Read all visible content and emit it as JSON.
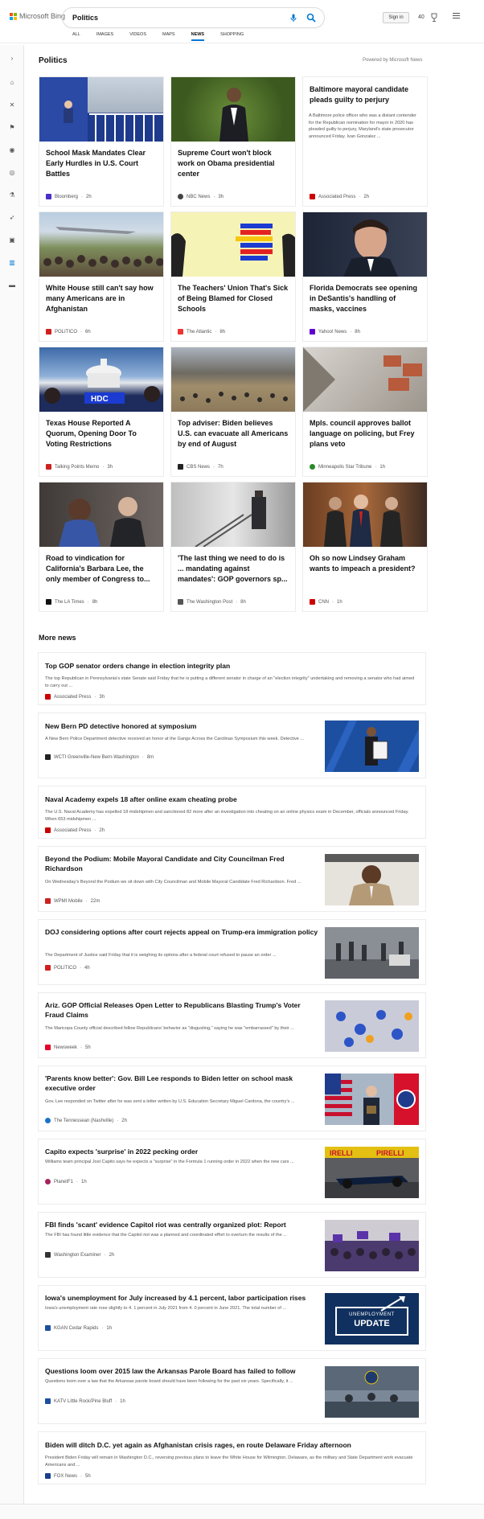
{
  "header": {
    "brand": "Microsoft Bing",
    "search_value": "Politics",
    "signin_label": "Sign in",
    "points": "40"
  },
  "tabs": [
    {
      "label": "ALL"
    },
    {
      "label": "IMAGES"
    },
    {
      "label": "VIDEOS"
    },
    {
      "label": "MAPS"
    },
    {
      "label": "NEWS"
    },
    {
      "label": "SHOPPING"
    }
  ],
  "rail_icons": [
    "chevron-right-icon",
    "home-icon",
    "tools-icon",
    "flag-icon",
    "location-icon",
    "globe-icon",
    "science-icon",
    "rocket-icon",
    "film-icon",
    "bank-icon",
    "card-icon"
  ],
  "page": {
    "title": "Politics",
    "powered_by": "Powered by Microsoft News",
    "more_news_title": "More news"
  },
  "cards": [
    {
      "title": "School Mask Mandates Clear Early Hurdles in U.S. Court Battles",
      "source": "Bloomberg",
      "age": "2h",
      "logo_color": "#4b2fc8"
    },
    {
      "title": "Supreme Court won't block work on Obama presidential center",
      "source": "NBC News",
      "age": "3h",
      "logo_color": "#444"
    },
    {
      "title": "Baltimore mayoral candidate pleads guilty to perjury",
      "desc": "A Baltimore police officer who was a distant contender for the Republican nomination for mayor in 2020 has pleaded guilty to perjury, Maryland's state prosecutor announced Friday. Ivan Gonzalez ...",
      "source": "Associated Press",
      "age": "2h",
      "logo_color": "#c00"
    },
    {
      "title": "White House still can't say how many Americans are in Afghanistan",
      "source": "POLITICO",
      "age": "6h",
      "logo_color": "#d21f1f"
    },
    {
      "title": "The Teachers' Union That's Sick of Being Blamed for Closed Schools",
      "source": "The Atlantic",
      "age": "8h",
      "logo_color": "#e33"
    },
    {
      "title": "Florida Democrats see opening in DeSantis's handling of masks, vaccines",
      "source": "Yahoo! News",
      "age": "8h",
      "logo_color": "#6001d2"
    },
    {
      "title": "Texas House Reported A Quorum, Opening Door To Voting Restrictions",
      "source": "Talking Points Memo",
      "age": "3h",
      "logo_color": "#c22"
    },
    {
      "title": "Top adviser: Biden believes U.S. can evacuate all Americans by end of August",
      "source": "CBS News",
      "age": "7h",
      "logo_color": "#222"
    },
    {
      "title": "Mpls. council approves ballot language on policing, but Frey plans veto",
      "source": "Minneapolis Star Tribune",
      "age": "1h",
      "logo_color": "#2a8a2a"
    },
    {
      "title": "Road to vindication for California's Barbara Lee, the only member of Congress to...",
      "source": "The LA Times",
      "age": "8h",
      "logo_color": "#111"
    },
    {
      "title": "'The last thing we need to do is ... mandating against mandates': GOP governors sp...",
      "source": "The Washington Post",
      "age": "8h",
      "logo_color": "#555"
    },
    {
      "title": "Oh so now Lindsey Graham wants to impeach a president?",
      "source": "CNN",
      "age": "1h",
      "logo_color": "#cc0000"
    }
  ],
  "more_news": [
    {
      "title": "Top GOP senator orders change in election integrity plan",
      "desc": "The top Republican in Pennsylvania's state Senate said Friday that he is putting a different senator in charge of an \"election integrity\" undertaking and removing a senator who had aimed to carry out ...",
      "source": "Associated Press",
      "age": "3h",
      "logo_color": "#c00"
    },
    {
      "title": "New Bern PD detective honored at symposium",
      "desc": "A New Bern Police Department detective received an honor at the Gangs Across the Carolinas Symposium this week. Detective ...",
      "source": "WCTI Greenville-New Bern-Washington",
      "age": "8m",
      "logo_color": "#222"
    },
    {
      "title": "Naval Academy expels 18 after online exam cheating probe",
      "desc": "The U.S. Naval Academy has expelled 18 midshipmen and sanctioned 82 more after an investigation into cheating on an online physics exam in December, officials announced Friday. When 653 midshipmen ...",
      "source": "Associated Press",
      "age": "2h",
      "logo_color": "#c00"
    },
    {
      "title": "Beyond the Podium: Mobile Mayoral Candidate and City Councilman Fred Richardson",
      "desc": "On Wednesday's Beyond the Podium we sit down with City Councilman and Mobile Mayoral Candidate Fred Richardson. Fred ...",
      "source": "WPMI Mobile",
      "age": "22m",
      "logo_color": "#c22"
    },
    {
      "title": "DOJ considering options after court rejects appeal on Trump-era immigration policy",
      "desc": "The Department of Justice said Friday that it is weighing its options after a federal court refused to pause an order ...",
      "source": "POLITICO",
      "age": "4h",
      "logo_color": "#d21f1f"
    },
    {
      "title": "Ariz. GOP Official Releases Open Letter to Republicans Blasting Trump's Voter Fraud Claims",
      "desc": "The Maricopa County official described fellow Republicans' behavior as \"disgusting,\" saying he was \"embarrassed\" by their ...",
      "source": "Newsweek",
      "age": "5h",
      "logo_color": "#e4002b"
    },
    {
      "title": "'Parents know better': Gov. Bill Lee responds to Biden letter on school mask executive order",
      "desc": "Gov. Lee responded on Twitter after he was sent a letter written by U.S. Education Secretary Miguel Cardona, the country's ...",
      "source": "The Tennessean (Nashville)",
      "age": "2h",
      "logo_color": "#1a73c8"
    },
    {
      "title": "Capito expects 'surprise' in 2022 pecking order",
      "desc": "Williams team principal Jost Capito says he expects a \"surprise\" in the Formula 1 running order in 2022 when the new cars ...",
      "source": "PlanetF1",
      "age": "1h",
      "logo_color": "#a3235b"
    },
    {
      "title": "FBI finds 'scant' evidence Capitol riot was centrally organized plot: Report",
      "desc": "The FBI has found little evidence that the Capitol riot was a planned and coordinated effort to overturn the results of the ...",
      "source": "Washington Examiner",
      "age": "2h",
      "logo_color": "#333"
    },
    {
      "title": "Iowa's unemployment for July increased by 4.1 percent, labor participation rises",
      "desc": "Iowa's unemployment rate rose slightly to 4. 1 percent in July 2021 from 4. 0 percent in June 2021. The total number of ...",
      "source": "KGAN Cedar Rapids",
      "age": "1h",
      "logo_color": "#1d4fa0",
      "image_text_1": "UNEMPLOYMENT",
      "image_text_2": "UPDATE"
    },
    {
      "title": "Questions loom over 2015 law the Arkansas Parole Board has failed to follow",
      "desc": "Questions loom over a law that the Arkansas parole board should have been following for the past six years. Specifically, it ...",
      "source": "KATV Little Rock/Pine Bluff",
      "age": "1h",
      "logo_color": "#1d4fa0"
    },
    {
      "title": "Biden will ditch D.C. yet again as Afghanistan crisis rages, en route Delaware Friday afternoon",
      "desc": "President Biden Friday will remain in Washington D.C., reversing previous plans to leave the White House for Wilmington, Delaware, as the military and State Department work evacuate Americans and ...",
      "source": "FOX News",
      "age": "5h",
      "logo_color": "#1a3e8c"
    }
  ],
  "footer": {
    "left": "",
    "right": ""
  }
}
